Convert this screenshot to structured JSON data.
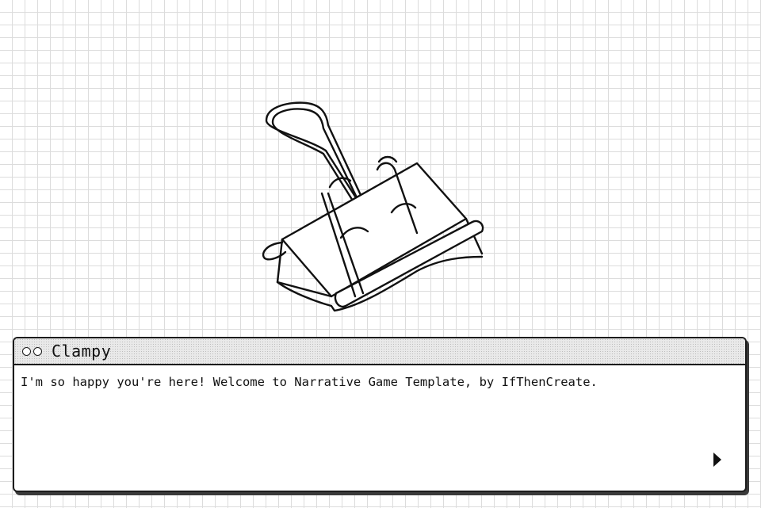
{
  "speaker": {
    "name": "Clampy"
  },
  "dialogue": {
    "text": "I'm so happy you're here! Welcome to Narrative Game Template, by IfThenCreate."
  },
  "character": {
    "icon": "binder-clip-character"
  },
  "controls": {
    "advance_icon": "play-triangle-icon"
  }
}
